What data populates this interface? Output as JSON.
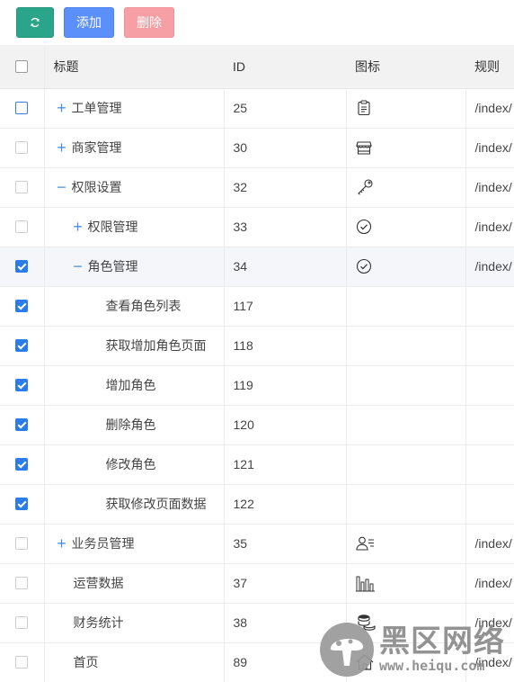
{
  "toolbar": {
    "refresh_icon": "refresh-icon",
    "add_label": "添加",
    "delete_label": "删除",
    "colors": {
      "refresh": "#2aa58a",
      "add": "#5b8ff9",
      "delete": "#f6a0a5"
    }
  },
  "table": {
    "headers": {
      "title": "标题",
      "id": "ID",
      "icon": "图标",
      "rule": "规则"
    },
    "rows": [
      {
        "toggle": "+",
        "title": "工单管理",
        "id": "25",
        "icon": "clipboard-icon",
        "rule": "/index/"
      },
      {
        "toggle": "+",
        "title": "商家管理",
        "id": "30",
        "icon": "store-icon",
        "rule": "/index/"
      },
      {
        "toggle": "−",
        "title": "权限设置",
        "id": "32",
        "icon": "key-icon",
        "rule": "/index/"
      },
      {
        "toggle": "+",
        "title": "权限管理",
        "id": "33",
        "icon": "check-circle-icon",
        "rule": "/index/"
      },
      {
        "toggle": "−",
        "title": "角色管理",
        "id": "34",
        "icon": "check-circle-icon",
        "rule": "/index/"
      },
      {
        "toggle": "",
        "title": "查看角色列表",
        "id": "117",
        "icon": "",
        "rule": ""
      },
      {
        "toggle": "",
        "title": "获取增加角色页面",
        "id": "118",
        "icon": "",
        "rule": ""
      },
      {
        "toggle": "",
        "title": "增加角色",
        "id": "119",
        "icon": "",
        "rule": ""
      },
      {
        "toggle": "",
        "title": "删除角色",
        "id": "120",
        "icon": "",
        "rule": ""
      },
      {
        "toggle": "",
        "title": "修改角色",
        "id": "121",
        "icon": "",
        "rule": ""
      },
      {
        "toggle": "",
        "title": "获取修改页面数据",
        "id": "122",
        "icon": "",
        "rule": ""
      },
      {
        "toggle": "+",
        "title": "业务员管理",
        "id": "35",
        "icon": "user-list-icon",
        "rule": "/index/"
      },
      {
        "toggle": "",
        "title": "运营数据",
        "id": "37",
        "icon": "bar-chart-icon",
        "rule": "/index/"
      },
      {
        "toggle": "",
        "title": "财务统计",
        "id": "38",
        "icon": "coins-icon",
        "rule": "/index/"
      },
      {
        "toggle": "",
        "title": "首页",
        "id": "89",
        "icon": "home-icon",
        "rule": "/index/"
      }
    ]
  },
  "watermark": {
    "text": "黑区网络",
    "url": "www.heiqu.com"
  }
}
